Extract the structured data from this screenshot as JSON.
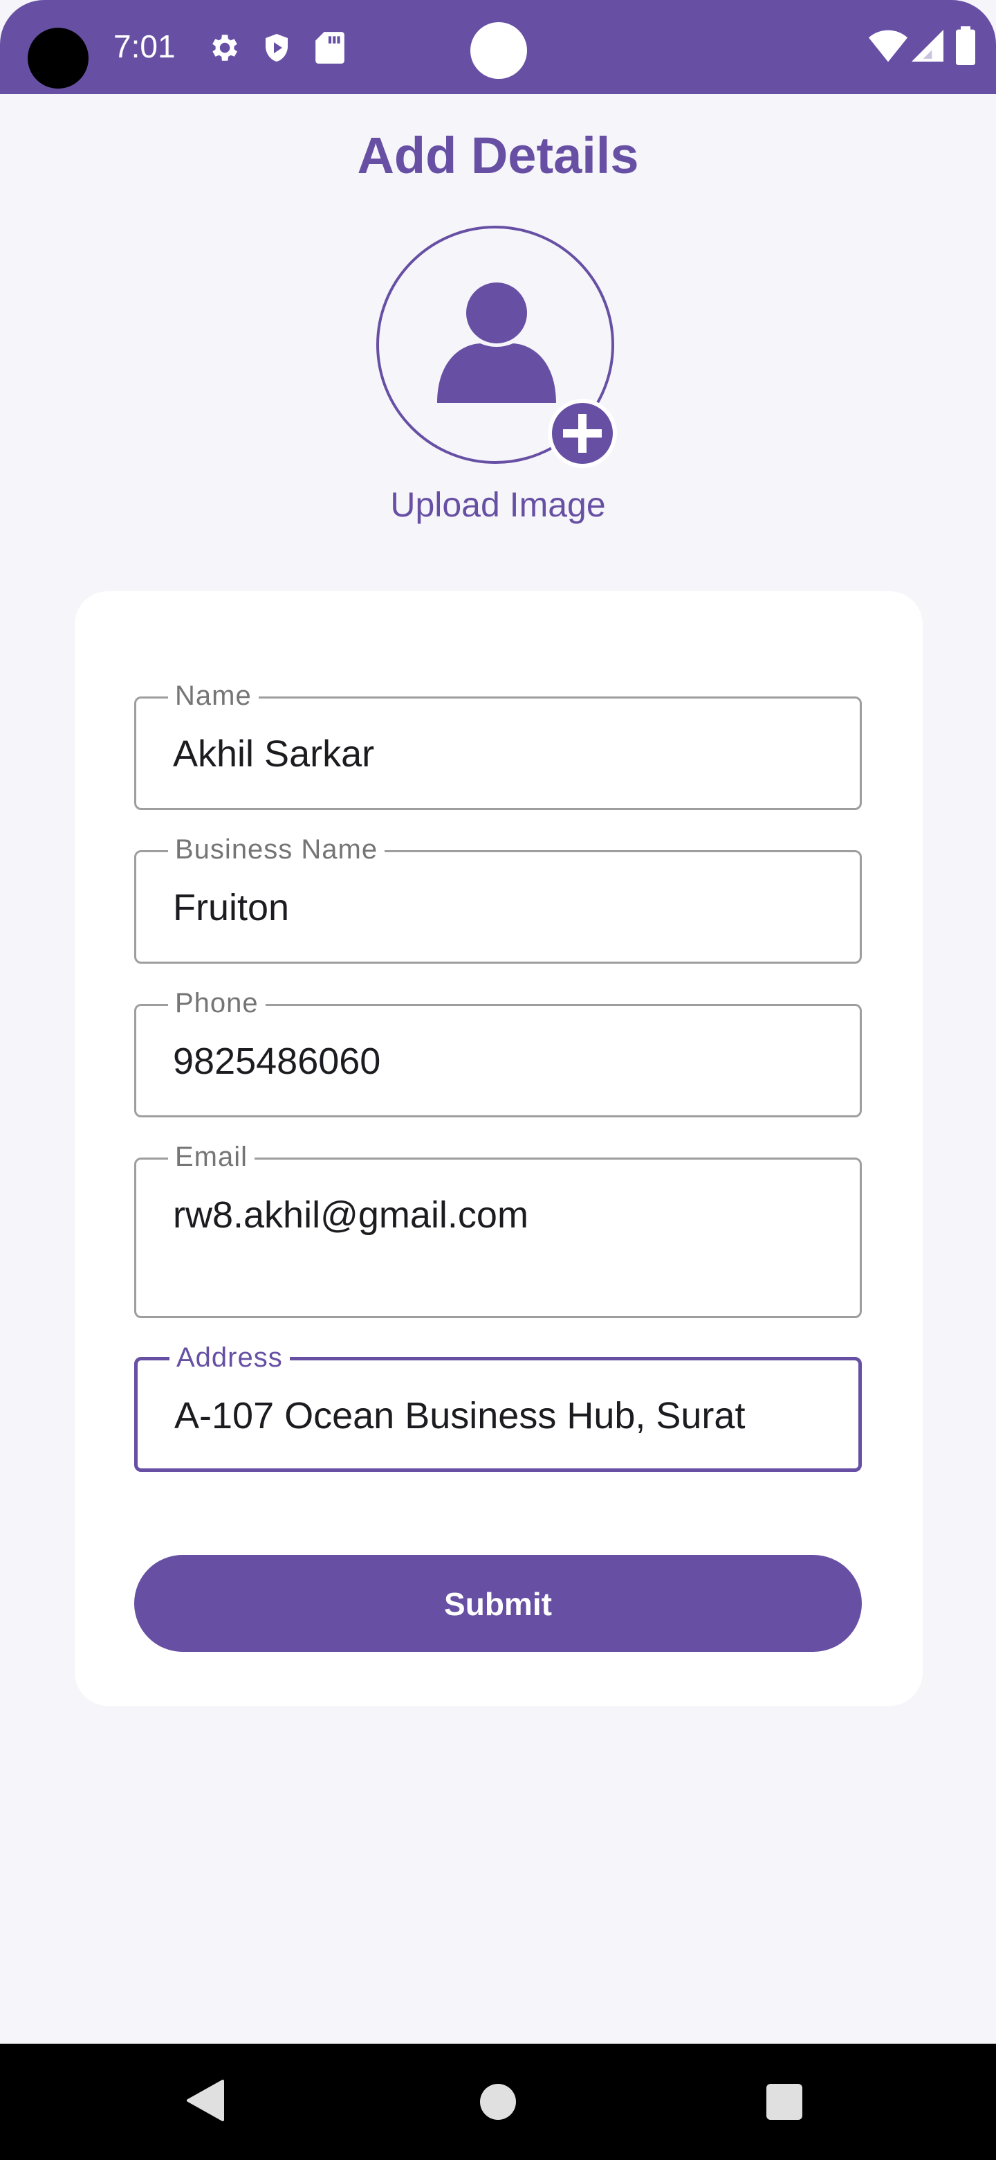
{
  "status_bar": {
    "time": "7:01",
    "icons": [
      "gear-icon",
      "shield-play-icon",
      "sd-card-icon",
      "wifi-icon",
      "signal-icon",
      "battery-icon"
    ],
    "color": "#6750a4"
  },
  "page": {
    "title": "Add Details"
  },
  "avatar": {
    "icon": "person-icon",
    "add_icon": "plus-circle-icon",
    "upload_label": "Upload Image"
  },
  "form": {
    "fields": [
      {
        "label": "Name",
        "value": "Akhil Sarkar"
      },
      {
        "label": "Business Name",
        "value": "Fruiton"
      },
      {
        "label": "Phone",
        "value": "9825486060"
      },
      {
        "label": "Email",
        "value": "rw8.akhil@gmail.com"
      },
      {
        "label": "Address",
        "value": "A-107 Ocean Business Hub, Surat"
      }
    ],
    "submit_label": "Submit"
  },
  "nav_bar": {
    "icons": [
      "back-icon",
      "home-icon",
      "recents-icon"
    ]
  },
  "colors": {
    "accent": "#6750a4",
    "background": "#f5f5fa",
    "card": "#ffffff",
    "outline": "#9e9e9e"
  }
}
